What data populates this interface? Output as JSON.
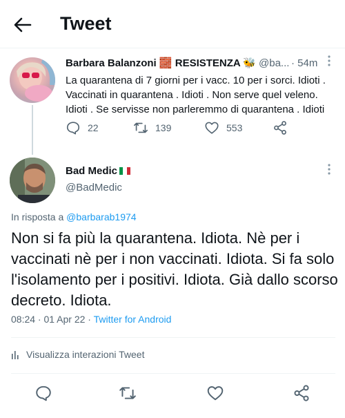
{
  "header": {
    "title": "Tweet"
  },
  "parent_tweet": {
    "display_name": "Barbara Balanzoni",
    "name_emoji": "🧱",
    "name_suffix": "RESISTENZA",
    "suffix_emoji": "🐝",
    "handle": "@ba...",
    "time": "· 54m",
    "text": "La quarantena di 7 giorni per i vacc. 10 per i sorci. Idioti . Vaccinati in quarantena . Idioti . Non serve quel veleno. Idioti . Se servisse non parleremmo di quarantena . Idioti",
    "replies": "22",
    "retweets": "139",
    "likes": "553"
  },
  "main_tweet": {
    "display_name": "Bad Medic",
    "handle": "@BadMedic",
    "reply_prefix": "In risposta a",
    "reply_mention": "@barbarab1974",
    "text": "Non si fa più la quarantena. Idiota. Nè per i vaccinati nè per i non vaccinati. Idiota. Si fa solo l'isolamento per i positivi. Idiota. Già  dallo scorso decreto. Idiota.",
    "timestamp": "08:24 · 01 Apr 22 ·",
    "source": "Twitter for Android",
    "analytics_label": "Visualizza interazioni Tweet"
  },
  "icons": {
    "back": "arrow-left-icon",
    "reply": "reply-icon",
    "retweet": "retweet-icon",
    "like": "heart-icon",
    "share": "share-icon",
    "more": "more-vertical-icon",
    "analytics": "bar-chart-icon"
  },
  "colors": {
    "text": "#0f1419",
    "secondary": "#536471",
    "link": "#1d9bf0",
    "divider": "#eff3f4"
  }
}
